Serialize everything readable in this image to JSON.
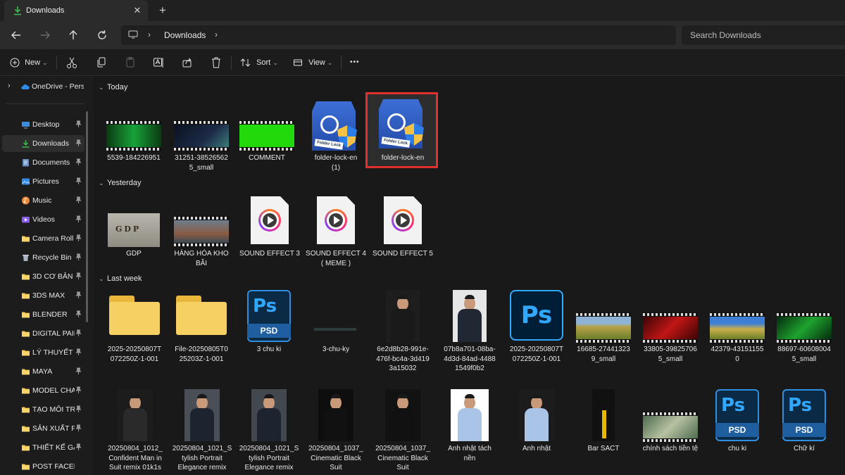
{
  "tab": {
    "title": "Downloads",
    "close": "✕",
    "new_tab": "+"
  },
  "address": {
    "crumb": "Downloads",
    "search_placeholder": "Search Downloads"
  },
  "toolbar": {
    "new_label": "New",
    "sort_label": "Sort",
    "view_label": "View",
    "more": "•••",
    "dropdown": "⌄"
  },
  "sidebar": {
    "onedrive": "OneDrive - Perso",
    "items": [
      {
        "label": "Desktop",
        "icon": "desktop-icon",
        "pinned": true
      },
      {
        "label": "Downloads",
        "icon": "downloads-icon",
        "pinned": true,
        "selected": true
      },
      {
        "label": "Documents",
        "icon": "documents-icon",
        "pinned": true
      },
      {
        "label": "Pictures",
        "icon": "pictures-icon",
        "pinned": true
      },
      {
        "label": "Music",
        "icon": "music-icon",
        "pinned": true
      },
      {
        "label": "Videos",
        "icon": "videos-icon",
        "pinned": true
      },
      {
        "label": "Camera Roll",
        "icon": "folder-icon",
        "pinned": true
      },
      {
        "label": "Recycle Bin",
        "icon": "recycle-bin-icon",
        "pinned": true
      },
      {
        "label": "3D CƠ BẢN",
        "icon": "folder-icon",
        "pinned": true
      },
      {
        "label": "3DS MAX",
        "icon": "folder-icon",
        "pinned": true
      },
      {
        "label": "BLENDER",
        "icon": "folder-icon",
        "pinned": true
      },
      {
        "label": "DIGITAL PAIN",
        "icon": "folder-icon",
        "pinned": true
      },
      {
        "label": "LÝ THUYẾT G",
        "icon": "folder-icon",
        "pinned": true
      },
      {
        "label": "MAYA",
        "icon": "folder-icon",
        "pinned": true
      },
      {
        "label": "MODEL CHAI",
        "icon": "folder-icon",
        "pinned": true
      },
      {
        "label": "TẠO MÔI TRI",
        "icon": "folder-icon",
        "pinned": true
      },
      {
        "label": "SẢN XUẤT PI",
        "icon": "folder-icon",
        "pinned": true
      },
      {
        "label": "THIẾT KẾ GAI",
        "icon": "folder-icon",
        "pinned": true
      },
      {
        "label": "POST FACEBOOI",
        "icon": "folder-icon",
        "pinned": false
      }
    ]
  },
  "groups": {
    "today": "Today",
    "yesterday": "Yesterday",
    "last_week": "Last week"
  },
  "files": {
    "today": [
      {
        "name": "5539-184226951",
        "type": "video"
      },
      {
        "name": "31251-38526562\n5_small",
        "type": "video"
      },
      {
        "name": "COMMENT",
        "type": "video"
      },
      {
        "name": "folder-lock-en\n(1)",
        "type": "installer"
      },
      {
        "name": "folder-lock-en",
        "type": "installer",
        "selected": true
      }
    ],
    "yesterday": [
      {
        "name": "GDP",
        "type": "image"
      },
      {
        "name": "HÀNG HÓA KHO\nBÃI",
        "type": "video"
      },
      {
        "name": "SOUND EFFECT 3",
        "type": "audio"
      },
      {
        "name": "SOUND EFFECT 4\n( MEME )",
        "type": "audio"
      },
      {
        "name": "SOUND EFFECT 5",
        "type": "audio"
      }
    ],
    "last_week_row1": [
      {
        "name": "2025-20250807T\n072250Z-1-001",
        "type": "folder"
      },
      {
        "name": "File-20250805T0\n25203Z-1-001",
        "type": "folder"
      },
      {
        "name": "3 chu ki",
        "type": "psd"
      },
      {
        "name": "3-chu-ky",
        "type": "image"
      },
      {
        "name": "6e2d8b28-991e-\n476f-bc4a-3d419\n3a15032",
        "type": "image"
      },
      {
        "name": "07b8a701-08ba-\n4d3d-84ad-4488\n1549f0b2",
        "type": "image"
      },
      {
        "name": "2025-20250807T\n072250Z-1-001",
        "type": "ps"
      },
      {
        "name": "16685-27441323\n9_small",
        "type": "video"
      },
      {
        "name": "33805-39825706\n5_small",
        "type": "video"
      },
      {
        "name": "42379-43151155\n0",
        "type": "video"
      },
      {
        "name": "88697-60608004\n5_small",
        "type": "video"
      }
    ],
    "last_week_row2": [
      {
        "name": "20250804_1012_\nConfident Man in\nSuit remix 01k1s",
        "type": "image"
      },
      {
        "name": "20250804_1021_S\ntylish Portrait\nElegance remix",
        "type": "image"
      },
      {
        "name": "20250804_1021_S\ntylish Portrait\nElegance remix",
        "type": "image"
      },
      {
        "name": "20250804_1037_\nCinematic Black\nSuit",
        "type": "image"
      },
      {
        "name": "20250804_1037_\nCinematic Black\nSuit",
        "type": "image"
      },
      {
        "name": "Anh nhật tách\nnền",
        "type": "image"
      },
      {
        "name": "Anh nhật",
        "type": "image"
      },
      {
        "name": "Bar SACT",
        "type": "image"
      },
      {
        "name": "chính sách tiền tệ",
        "type": "video"
      },
      {
        "name": "chu ki",
        "type": "psd"
      },
      {
        "name": "Chữ kí",
        "type": "psd"
      }
    ]
  },
  "thumb_text": {
    "ps": "Ps",
    "psd": "PSD",
    "gdp": "GDP",
    "folder_lock": "Folder Lock"
  },
  "colors": {
    "selection_outline": "#e0312e",
    "ps_blue": "#31a8ff",
    "folder_yellow": "#f6d062"
  }
}
